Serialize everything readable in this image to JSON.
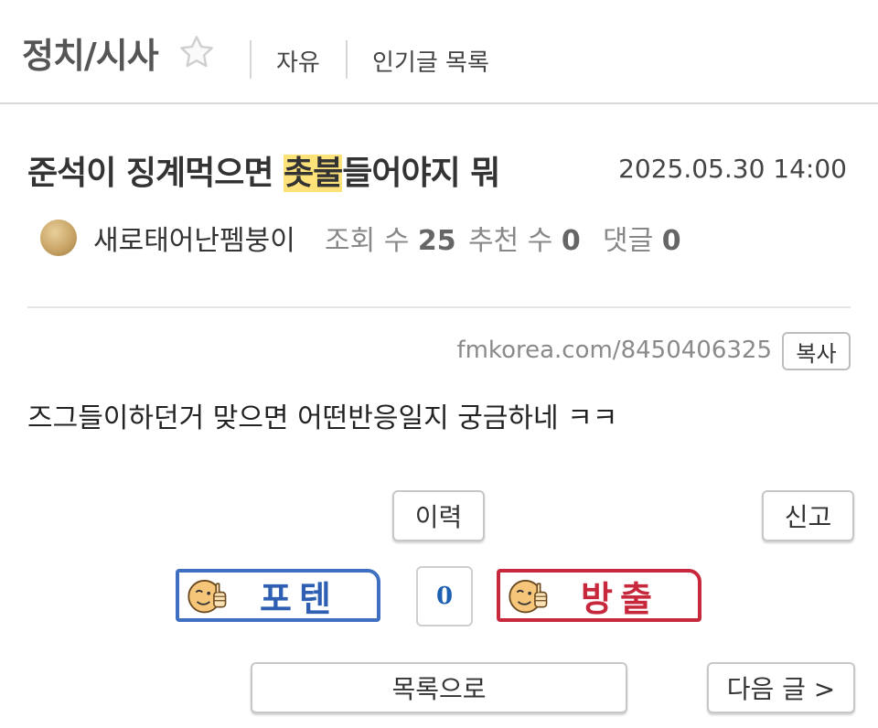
{
  "header": {
    "board_title": "정치/시사",
    "nav": [
      "자유",
      "인기글 목록"
    ]
  },
  "post": {
    "title_before": "준석이 징계먹으면 ",
    "title_highlight": "촛불",
    "title_after": "들어야지 뭐",
    "date": "2025.05.30 14:00",
    "author": "새로태어난펨붕이",
    "views_label": "조회 수",
    "views": "25",
    "recommends_label": "추천 수",
    "recommends": "0",
    "comments_label": "댓글",
    "comments": "0",
    "url": "fmkorea.com/8450406325",
    "copy_label": "복사",
    "body": "즈그들이하던거 맞으면 어떤반응일지 궁금하네 ㅋㅋ"
  },
  "actions": {
    "history_label": "이력",
    "report_label": "신고",
    "upvote_label": "포텐",
    "score": "0",
    "downvote_label": "방출",
    "list_label": "목록으로",
    "next_label": "다음 글 >"
  },
  "colors": {
    "highlight": "#fde27a",
    "upvote": "#3f6fc0",
    "downvote": "#c8283c",
    "score": "#1d5fb0"
  },
  "icons": [
    "star-icon",
    "avatar",
    "thumbs-up-face-icon"
  ]
}
